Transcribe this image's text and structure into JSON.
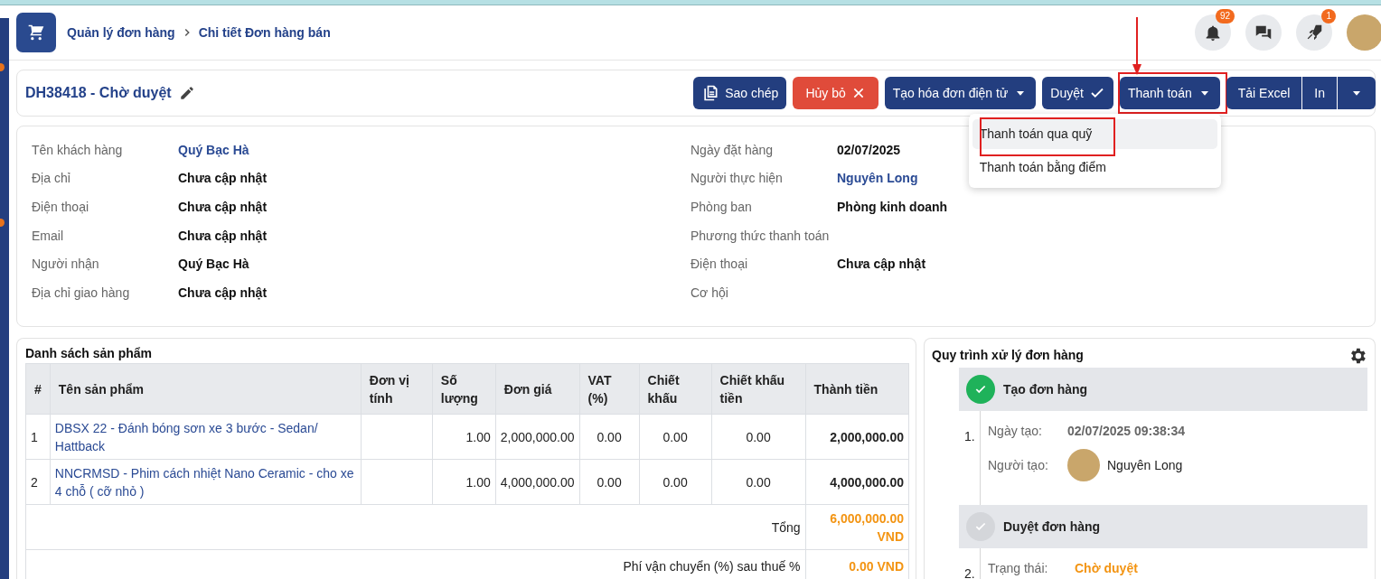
{
  "breadcrumb": [
    {
      "label": "Quản lý đơn hàng"
    },
    {
      "label": "Chi tiết Đơn hàng bán"
    }
  ],
  "header_icons": [
    {
      "kind": "bell",
      "badge": "92"
    },
    {
      "kind": "chat"
    },
    {
      "kind": "rocket",
      "badge": "1"
    },
    {
      "kind": "avatar"
    }
  ],
  "order": {
    "title": "DH38418 - Chờ duyệt"
  },
  "actions": [
    {
      "kind": "copy",
      "label": "Sao chép"
    },
    {
      "kind": "danger",
      "label": "Hủy bỏ"
    },
    {
      "kind": "dropdown",
      "label": "Tạo hóa đơn điện tử"
    },
    {
      "kind": "check",
      "label": "Duyệt"
    },
    {
      "kind": "dropdown",
      "label": "Thanh toán",
      "highlighted": true,
      "pointer": true,
      "expanded": true,
      "menu": [
        {
          "label": "Thanh toán qua quỹ",
          "selected": true,
          "highlighted": true
        },
        {
          "label": "Thanh toán bằng điểm",
          "selected": false,
          "highlighted": false
        }
      ]
    },
    {
      "kind": "split",
      "parts": [
        "Tải Excel",
        "In"
      ]
    }
  ],
  "info_left": [
    {
      "label": "Tên khách hàng",
      "value": "Quý Bạc Hà",
      "link": true
    },
    {
      "label": "Địa chỉ",
      "value": "Chưa cập nhật",
      "link": false
    },
    {
      "label": "Điện thoại",
      "value": "Chưa cập nhật",
      "link": false
    },
    {
      "label": "Email",
      "value": "Chưa cập nhật",
      "link": false
    },
    {
      "label": "Người nhận",
      "value": "Quý Bạc Hà",
      "link": false
    },
    {
      "label": "Địa chỉ giao hàng",
      "value": "Chưa cập nhật",
      "link": false
    }
  ],
  "info_right": [
    {
      "label": "Ngày đặt hàng",
      "value": "02/07/2025",
      "link": false
    },
    {
      "label": "Người thực hiện",
      "value": "Nguyên Long",
      "link": true
    },
    {
      "label": "Phòng ban",
      "value": "Phòng kinh doanh",
      "link": false
    },
    {
      "label": "Phương thức thanh toán"
    },
    {
      "label": "Điện thoại",
      "value": "Chưa cập nhật",
      "link": false
    },
    {
      "label": "Cơ hội"
    }
  ],
  "products": {
    "title": "Danh sách sản phẩm",
    "columns": [
      {
        "label": "#",
        "kind": "index"
      },
      {
        "label": "Tên sản phẩm",
        "kind": "link"
      },
      {
        "label": "Đơn vị tính",
        "kind": "text"
      },
      {
        "label": "Số lượng",
        "kind": "number"
      },
      {
        "label": "Đơn giá",
        "kind": "number"
      },
      {
        "label": "VAT (%)",
        "kind": "center"
      },
      {
        "label": "Chiết khấu",
        "kind": "center"
      },
      {
        "label": "Chiết khấu tiền",
        "kind": "center"
      },
      {
        "label": "Thành tiền",
        "kind": "total"
      }
    ],
    "rows": [
      [
        "1",
        "DBSX 22 - Đánh bóng sơn xe 3 bước - Sedan/ Hattback",
        "",
        "1.00",
        "2,000,000.00",
        "0.00",
        "0.00",
        "0.00",
        "2,000,000.00"
      ],
      [
        "2",
        "NNCRMSD - Phim cách nhiệt Nano Ceramic - cho xe 4 chỗ ( cỡ nhỏ )",
        "",
        "1.00",
        "4,000,000.00",
        "0.00",
        "0.00",
        "0.00",
        "4,000,000.00"
      ]
    ],
    "summary": [
      {
        "label": "Tổng",
        "value": "6,000,000.00 VND"
      },
      {
        "label": "Phí vận chuyển (%) sau thuế %",
        "value": "0.00 VND"
      }
    ]
  },
  "process": {
    "title": "Quy trình xử lý đơn hàng",
    "steps": [
      {
        "title": "Tạo đơn hàng",
        "done": true,
        "number": "1.",
        "fields": [
          {
            "kind": "date",
            "label": "Ngày tạo:",
            "value": "02/07/2025 09:38:34"
          },
          {
            "kind": "user",
            "label": "Người tạo:",
            "value": "Nguyên Long"
          }
        ]
      },
      {
        "title": "Duyệt đơn hàng",
        "done": false,
        "number": "2.",
        "fields": [
          {
            "kind": "status",
            "label": "Trạng thái:",
            "value": "Chờ duyệt"
          }
        ]
      }
    ]
  }
}
